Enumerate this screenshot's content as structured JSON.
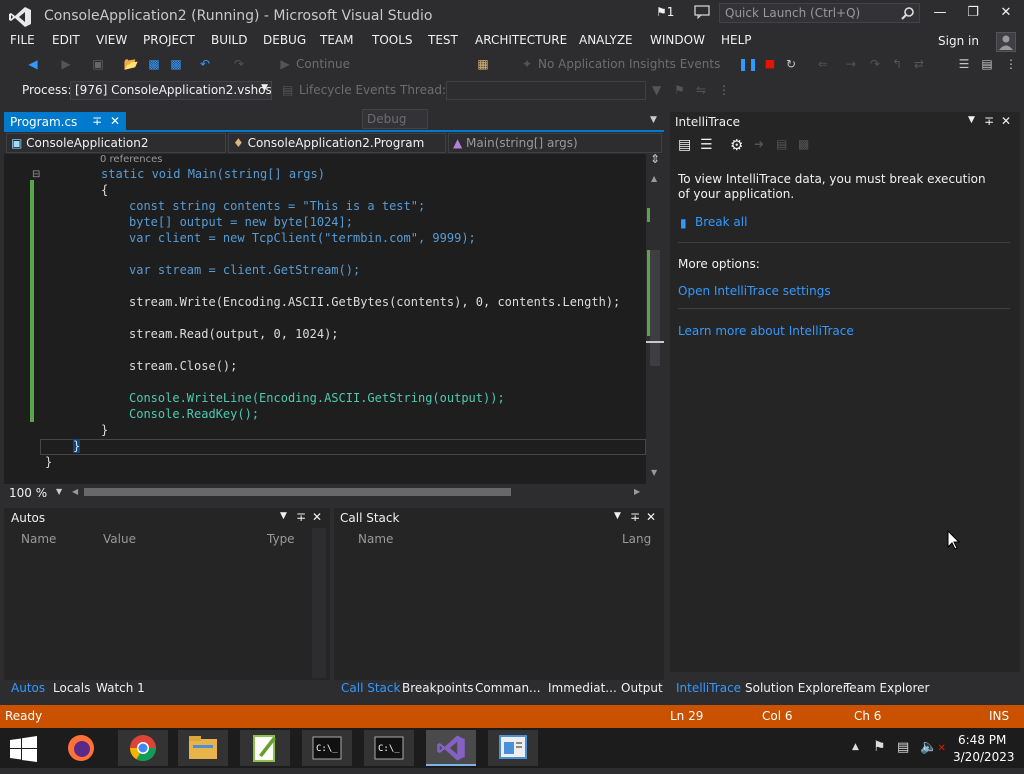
{
  "window": {
    "title": "ConsoleApplication2 (Running) - Microsoft Visual Studio",
    "notification_count": "1",
    "quick_launch_placeholder": "Quick Launch (Ctrl+Q)"
  },
  "menu": [
    "FILE",
    "EDIT",
    "VIEW",
    "PROJECT",
    "BUILD",
    "DEBUG",
    "TEAM",
    "TOOLS",
    "TEST",
    "ARCHITECTURE",
    "ANALYZE",
    "WINDOW",
    "HELP"
  ],
  "sign_in": "Sign in",
  "toolbar": {
    "continue_label": "Continue",
    "config_value": "Debug",
    "insights_label": "No Application Insights Events"
  },
  "debug_location": {
    "process_label": "Process:",
    "process_value": "[976] ConsoleApplication2.vshost.",
    "lifecycle_label": "Lifecycle Events",
    "thread_label": "Thread:"
  },
  "editor": {
    "tab_label": "Program.cs",
    "nav_project": "ConsoleApplication2",
    "nav_class": "ConsoleApplication2.Program",
    "nav_member": "Main(string[] args)",
    "references": "0 references",
    "zoom": "100 %"
  },
  "code_lines": [
    {
      "text": "static void Main(string[] args)"
    },
    {
      "text": "{"
    },
    {
      "text": "const string contents = \"This is a test\";"
    },
    {
      "text": "byte[] output = new byte[1024];"
    },
    {
      "text": "var client = new TcpClient(\"termbin.com\", 9999);"
    },
    {
      "text": ""
    },
    {
      "text": "var stream = client.GetStream();"
    },
    {
      "text": ""
    },
    {
      "text": "stream.Write(Encoding.ASCII.GetBytes(contents), 0, contents.Length);"
    },
    {
      "text": ""
    },
    {
      "text": "stream.Read(output, 0, 1024);"
    },
    {
      "text": ""
    },
    {
      "text": "stream.Close();"
    },
    {
      "text": ""
    },
    {
      "text": "Console.WriteLine(Encoding.ASCII.GetString(output));"
    },
    {
      "text": "Console.ReadKey();"
    },
    {
      "text": "}"
    },
    {
      "text": "}"
    },
    {
      "text": "}"
    }
  ],
  "autos": {
    "title": "Autos",
    "columns": [
      "Name",
      "Value",
      "Type"
    ],
    "tabs": [
      "Autos",
      "Locals",
      "Watch 1"
    ]
  },
  "callstack": {
    "title": "Call Stack",
    "columns": [
      "Name",
      "Lang"
    ],
    "tabs": [
      "Call Stack",
      "Breakpoints",
      "Comman...",
      "Immediat...",
      "Output"
    ]
  },
  "intellitrace": {
    "title": "IntelliTrace",
    "message": "To view IntelliTrace data, you must break execution of your application.",
    "break_all": "Break all",
    "more_options": "More options:",
    "open_settings": "Open IntelliTrace settings",
    "learn_more": "Learn more about IntelliTrace",
    "tabs": [
      "IntelliTrace",
      "Solution Explorer",
      "Team Explorer"
    ]
  },
  "status": {
    "text": "Ready",
    "ln": "Ln 29",
    "col": "Col 6",
    "ch": "Ch 6",
    "mode": "INS"
  },
  "taskbar": {
    "time": "6:48 PM",
    "date": "3/20/2023"
  },
  "colors": {
    "accent": "#007acc",
    "status_debug": "#ca5100",
    "background": "#2d2d30",
    "editor_bg": "#1e1e1e"
  }
}
